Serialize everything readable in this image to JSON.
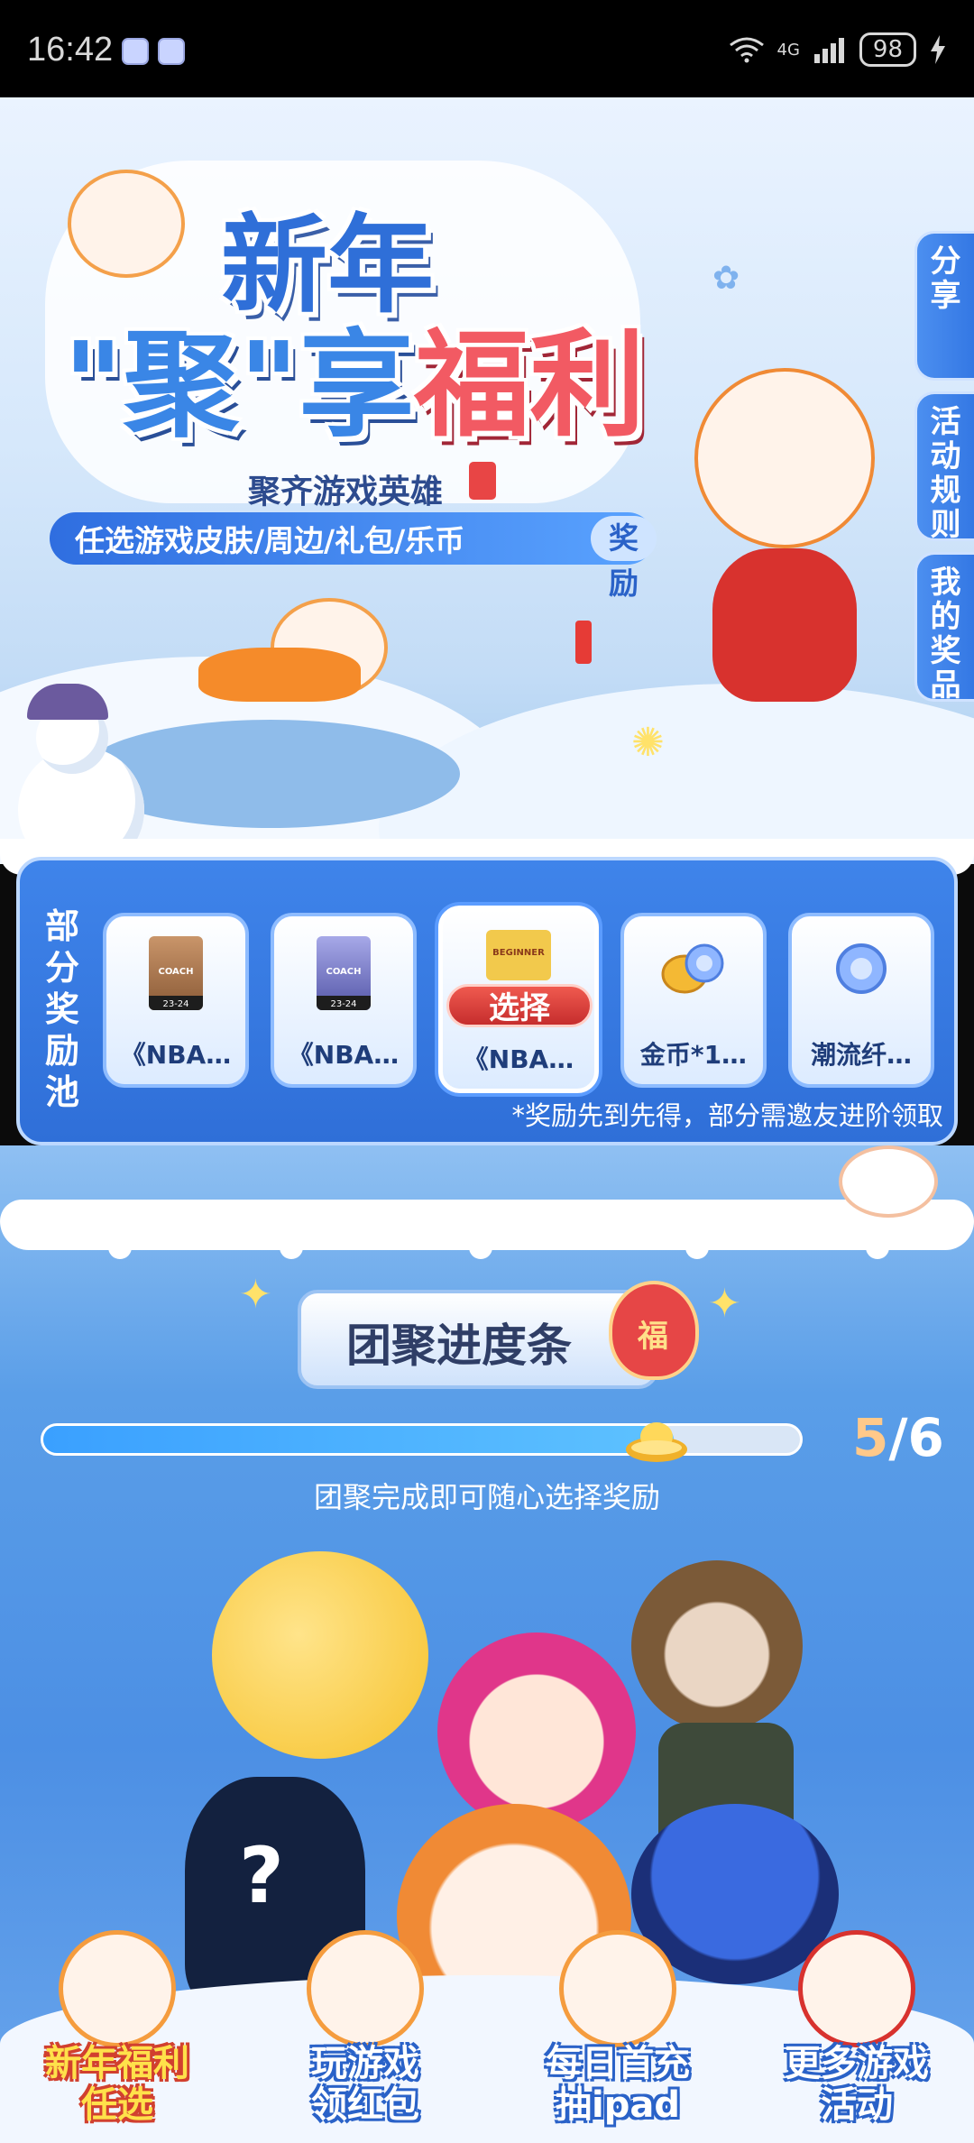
{
  "status_bar": {
    "time": "16:42",
    "network": "4G",
    "battery": "98"
  },
  "hero": {
    "title_line1": "新年",
    "title_quote_open": "\"",
    "title_ju": "聚",
    "title_quote_close": "\"",
    "title_xiang": "享",
    "title_fuli": "福利",
    "subtitle": "聚齐游戏英雄",
    "banner_text": "任选游戏皮肤/周边/礼包/乐币",
    "banner_reward": "奖励"
  },
  "side_tabs": {
    "share": "分享",
    "rules": "活动规则",
    "my_prizes": "我的奖品"
  },
  "reward_pool": {
    "label": "部分奖励池",
    "items": [
      {
        "name": "《NBA…",
        "card_text": "COACH",
        "band": "23-24"
      },
      {
        "name": "《NBA…",
        "card_text": "COACH",
        "band": "23-24"
      },
      {
        "name": "《NBA…",
        "card_text": "BEGINNER",
        "select_label": "选择"
      },
      {
        "name": "金币*1…"
      },
      {
        "name": "潮流纤…"
      }
    ],
    "note": "*奖励先到先得，部分需邀友进阶领取"
  },
  "progress": {
    "title": "团聚进度条",
    "fu_char": "福",
    "done": "5",
    "separator": "/",
    "total": "6",
    "fraction": 0.833,
    "hint": "团聚完成即可随心选择奖励",
    "mystery_mark": "?"
  },
  "bottom_nav": [
    {
      "label": "新年福利任选"
    },
    {
      "label": "玩游戏领红包"
    },
    {
      "label": "每日首充抽ipad"
    },
    {
      "label": "更多游戏活动"
    }
  ],
  "colors": {
    "primary_blue": "#2f6fd8",
    "accent_red": "#f25a63",
    "gold": "#ffc98a"
  }
}
